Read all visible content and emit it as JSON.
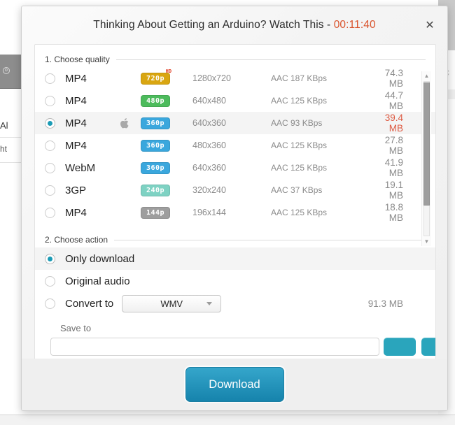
{
  "background": {
    "fragment_left_1": "Al",
    "fragment_left_2": "ht",
    "fragment_right": "nc",
    "dot_icon": "o"
  },
  "dialog": {
    "title_text": "Thinking About Getting an Arduino? Watch This - ",
    "duration": "00:11:40",
    "close_icon": "✕"
  },
  "quality_section": {
    "header": "1. Choose quality",
    "rows": [
      {
        "format": "MP4",
        "apple": "",
        "badge": "720p",
        "badge_color": "#d9a611",
        "hd_tag": "HD",
        "resolution": "1280x720",
        "audio": "AAC 187  KBps",
        "size": "74.3 MB",
        "selected": false
      },
      {
        "format": "MP4",
        "apple": "",
        "badge": "480p",
        "badge_color": "#4cbb5c",
        "hd_tag": "",
        "resolution": "640x480",
        "audio": "AAC 125  KBps",
        "size": "44.7 MB",
        "selected": false
      },
      {
        "format": "MP4",
        "apple": "apple-icon",
        "badge": "360p",
        "badge_color": "#3aa7dd",
        "hd_tag": "",
        "resolution": "640x360",
        "audio": "AAC 93  KBps",
        "size": "39.4 MB",
        "selected": true
      },
      {
        "format": "MP4",
        "apple": "",
        "badge": "360p",
        "badge_color": "#3aa7dd",
        "hd_tag": "",
        "resolution": "480x360",
        "audio": "AAC 125  KBps",
        "size": "27.8 MB",
        "selected": false
      },
      {
        "format": "WebM",
        "apple": "",
        "badge": "360p",
        "badge_color": "#3aa7dd",
        "hd_tag": "",
        "resolution": "640x360",
        "audio": "AAC 125  KBps",
        "size": "41.9 MB",
        "selected": false
      },
      {
        "format": "3GP",
        "apple": "",
        "badge": "240p",
        "badge_color": "#7ed2c3",
        "hd_tag": "",
        "resolution": "320x240",
        "audio": "AAC 37  KBps",
        "size": "19.1 MB",
        "selected": false
      },
      {
        "format": "MP4",
        "apple": "",
        "badge": "144p",
        "badge_color": "#9e9e9e",
        "hd_tag": "",
        "resolution": "196x144",
        "audio": "AAC 125  KBps",
        "size": "18.8 MB",
        "selected": false
      }
    ],
    "scrollbar": {
      "up_arrow": "▲",
      "down_arrow": "▼"
    }
  },
  "action_section": {
    "header": "2. Choose action",
    "options": [
      {
        "label": "Only download",
        "selected": true
      },
      {
        "label": "Original audio",
        "selected": false
      },
      {
        "label": "Convert to",
        "selected": false
      }
    ],
    "convert_format": "WMV",
    "convert_size": "91.3 MB"
  },
  "save_section": {
    "label": "Save to",
    "path": ""
  },
  "footer": {
    "download_label": "Download"
  },
  "colors": {
    "accent_teal": "#1b9bb5",
    "download_blue": "#1683ac",
    "highlight_red": "#dd5a42",
    "duration_orange": "#d9532c"
  }
}
